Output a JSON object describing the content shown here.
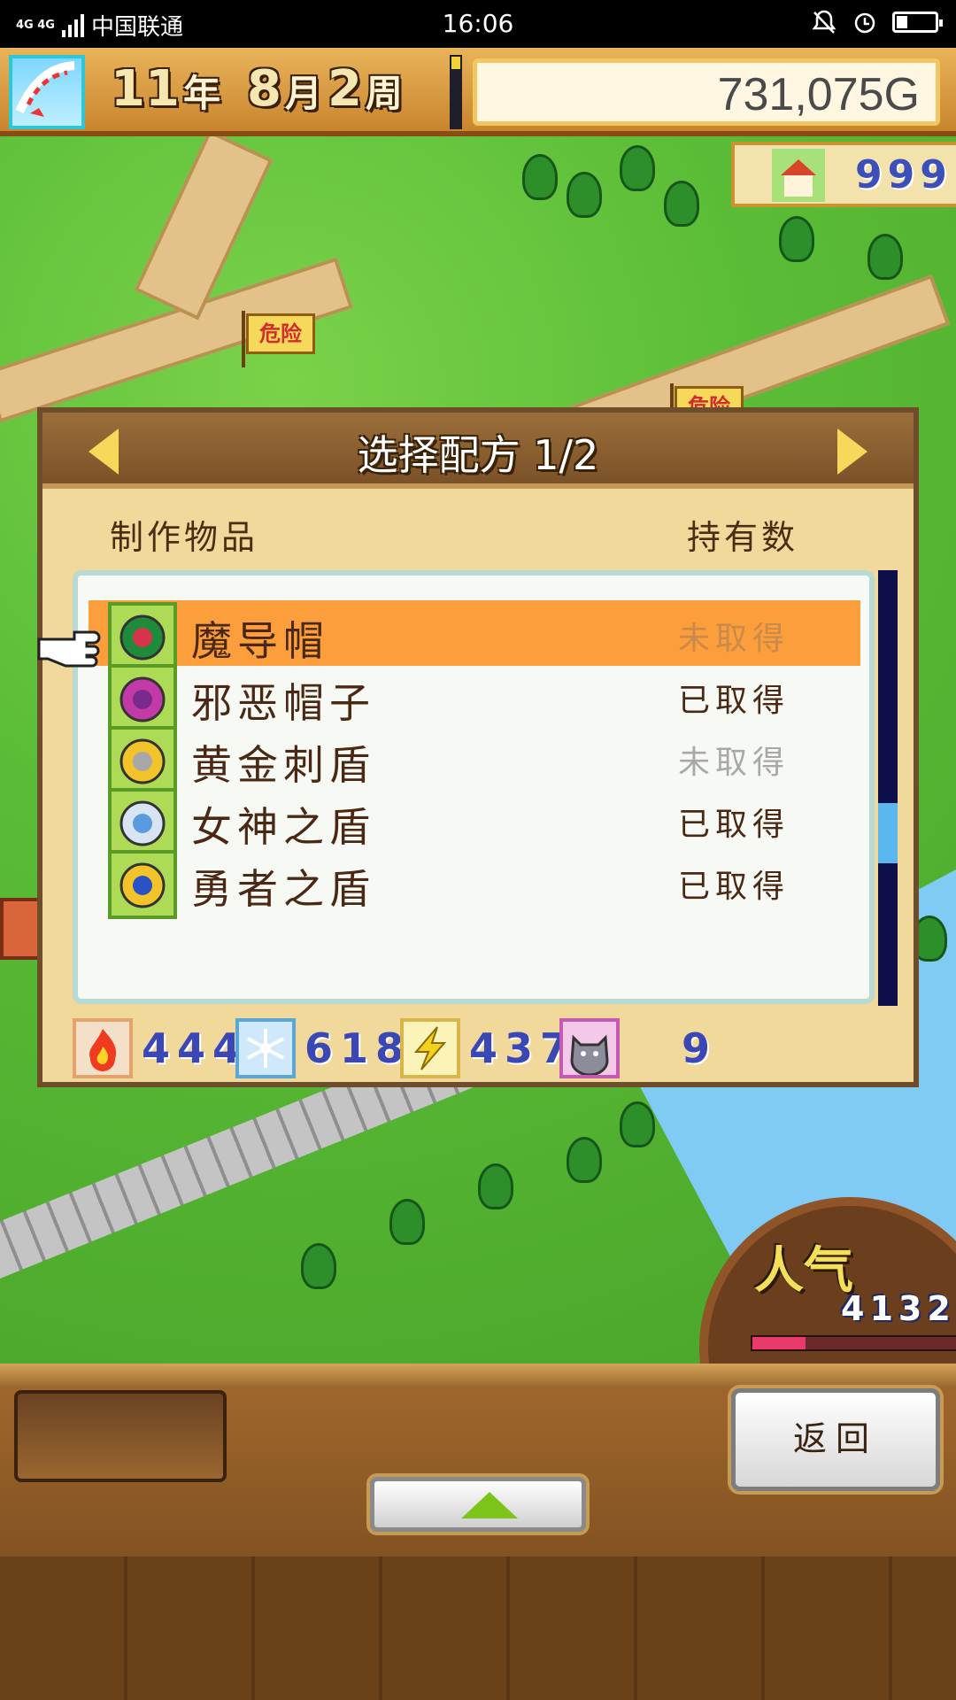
{
  "status_bar": {
    "network": "4G 4G",
    "carrier": "中国联通",
    "time": "16:06"
  },
  "hud": {
    "year_num": "11",
    "year_unit": "年",
    "month_num": "8",
    "month_unit": "月",
    "week_num": "2",
    "week_unit": "周",
    "money": "731,075G",
    "town_rank": "999"
  },
  "map": {
    "flag_text": "危险",
    "popularity_label": "人气",
    "popularity_value": "4132",
    "popularity_fill": 0.26
  },
  "panel": {
    "title": "选择配方 1/2",
    "col_item": "制作物品",
    "col_count": "持有数",
    "items": [
      {
        "name": "魔导帽",
        "status": "未取得",
        "obtained": false,
        "selected": true,
        "icon": "green-wizard-hat-icon"
      },
      {
        "name": "邪恶帽子",
        "status": "已取得",
        "obtained": true,
        "selected": false,
        "icon": "purple-evil-hat-icon"
      },
      {
        "name": "黄金刺盾",
        "status": "未取得",
        "obtained": false,
        "selected": false,
        "icon": "golden-spike-shield-icon"
      },
      {
        "name": "女神之盾",
        "status": "已取得",
        "obtained": true,
        "selected": false,
        "icon": "goddess-shield-icon"
      },
      {
        "name": "勇者之盾",
        "status": "已取得",
        "obtained": true,
        "selected": false,
        "icon": "hero-shield-icon"
      }
    ],
    "scroll_position": 0.62,
    "stats": [
      {
        "icon": "fire-icon",
        "value": "444",
        "color": "#ef3b1f"
      },
      {
        "icon": "ice-icon",
        "value": "618",
        "color": "#3aa5e6"
      },
      {
        "icon": "lightning-icon",
        "value": "437",
        "color": "#f2d21a"
      },
      {
        "icon": "cat-monster-icon",
        "value": "9",
        "color": "#a0a0b0"
      }
    ]
  },
  "bottom": {
    "back_label": "返回"
  },
  "colors": {
    "selected_row": "#fb9e3b",
    "stat_value": "#3a47b5",
    "hud_gold": "#e9b45a"
  }
}
